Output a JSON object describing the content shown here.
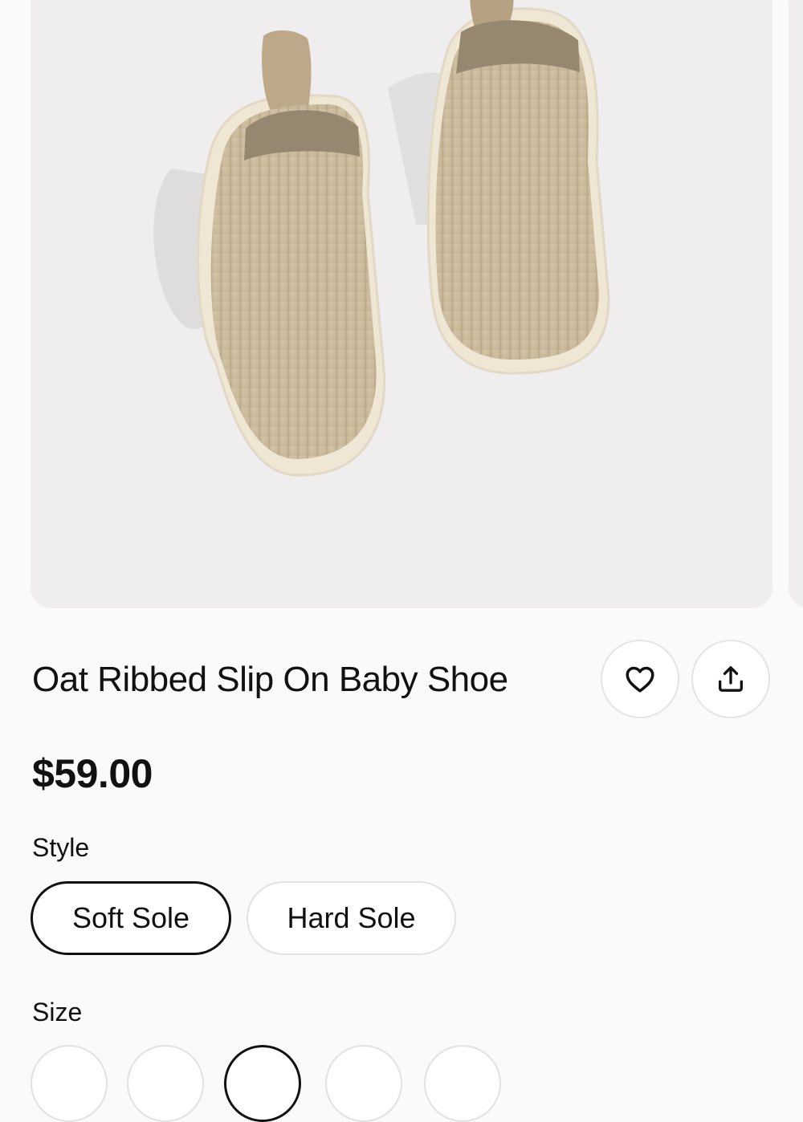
{
  "product": {
    "image_alt": "Oat ribbed suede slip-on baby shoes with pull tabs and cream soles",
    "title": "Oat Ribbed Slip On Baby Shoe",
    "price": "$59.00"
  },
  "actions": {
    "favorite_icon": "heart-icon",
    "share_icon": "share-icon"
  },
  "style": {
    "label": "Style",
    "options": [
      {
        "label": "Soft Sole",
        "selected": true
      },
      {
        "label": "Hard Sole",
        "selected": false
      }
    ]
  },
  "size": {
    "label": "Size",
    "options": [
      {
        "selected": false
      },
      {
        "selected": false
      },
      {
        "selected": true
      },
      {
        "selected": false
      },
      {
        "selected": false
      }
    ]
  },
  "colors": {
    "image_background": "#efedee",
    "shoe_suede": "#cdbd9f",
    "sole": "#efe7d4",
    "text": "#111111"
  }
}
